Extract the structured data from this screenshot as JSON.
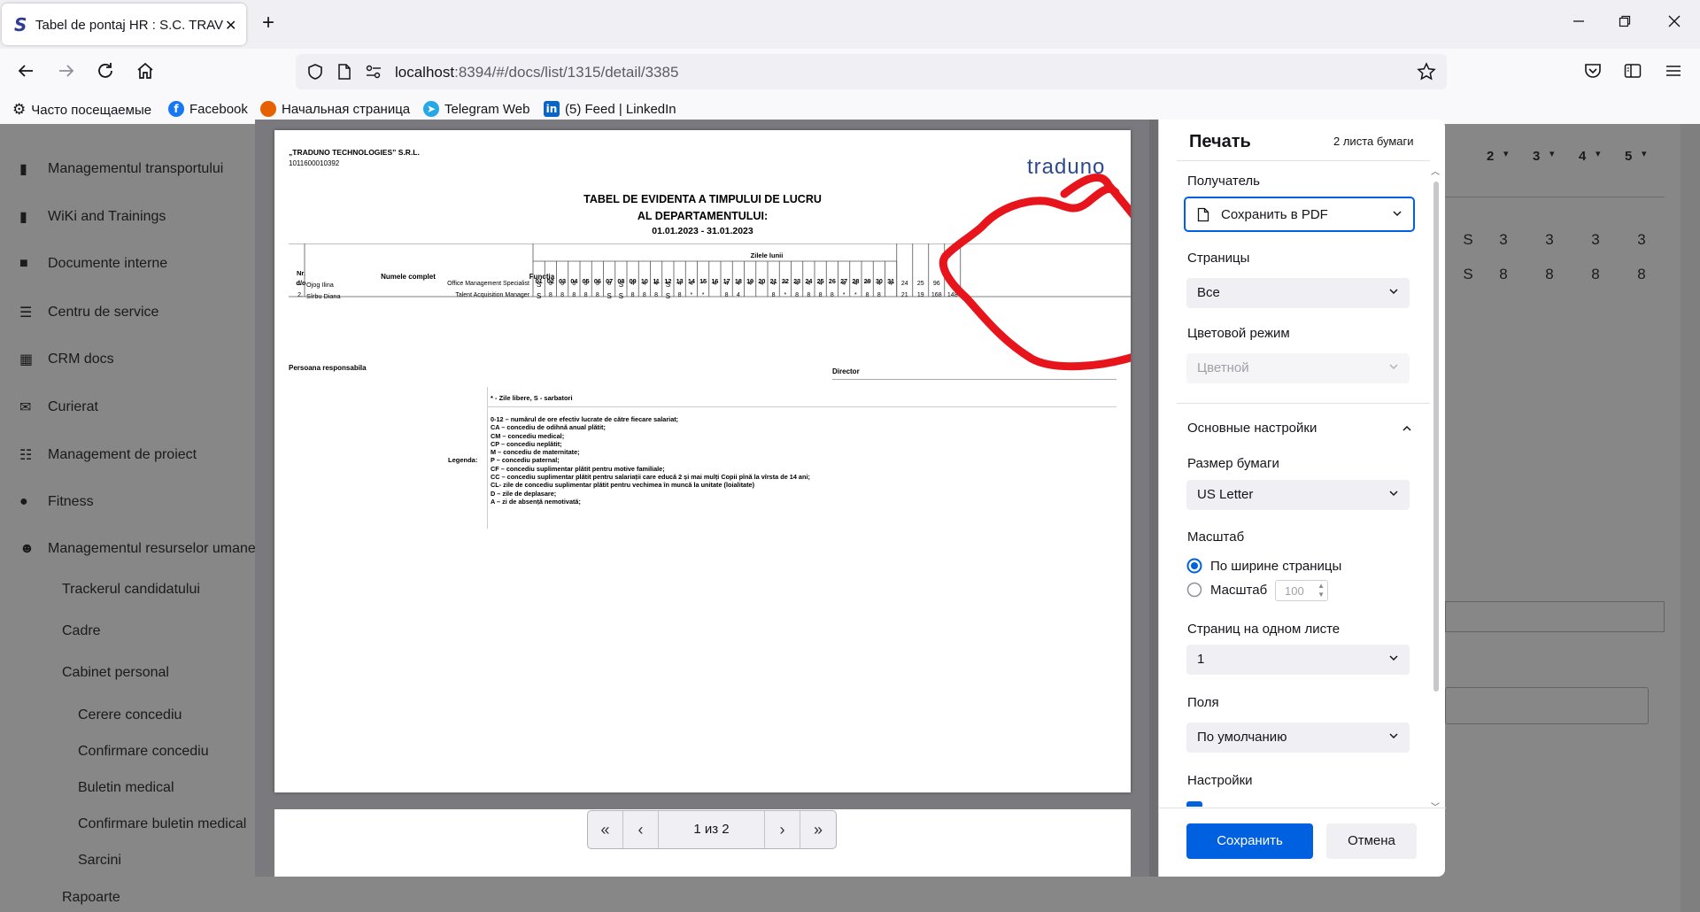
{
  "browser": {
    "tab_title": "Tabel de pontaj HR : S.C. TRAVO",
    "url_host": "localhost",
    "url_rest": ":8394/#/docs/list/1315/detail/3385",
    "bookmarks": [
      "Часто посещаемые",
      "Facebook",
      "Начальная страница",
      "Telegram Web",
      "(5) Feed | LinkedIn"
    ]
  },
  "sidebar": {
    "items": [
      {
        "label": "Managementul transportului",
        "icon": "truck-icon"
      },
      {
        "label": "WiKi and Trainings",
        "icon": "book-icon"
      },
      {
        "label": "Documente interne",
        "icon": "comment-icon"
      },
      {
        "label": "Centru de service",
        "icon": "list-icon"
      },
      {
        "label": "CRM docs",
        "icon": "calendar-icon"
      },
      {
        "label": "Curierat",
        "icon": "envelope-icon"
      },
      {
        "label": "Management de proiect",
        "icon": "tasks-icon"
      },
      {
        "label": "Fitness",
        "icon": "apple-icon"
      },
      {
        "label": "Managementul resurselor umane",
        "icon": "users-icon"
      }
    ],
    "subitems": [
      "Trackerul candidatului",
      "Cadre",
      "Cabinet personal"
    ],
    "subsubitems": [
      "Cerere concediu",
      "Confirmare concediu",
      "Buletin medical",
      "Confirmare buletin medical",
      "Sarcini"
    ],
    "bottom": "Rapoarte"
  },
  "background_grid": {
    "day_headers": [
      "2",
      "3",
      "4",
      "5"
    ],
    "row1": [
      "S",
      "3",
      "3",
      "3",
      "3"
    ],
    "row2": [
      "S",
      "8",
      "8",
      "8",
      "8"
    ]
  },
  "document": {
    "company": "„TRADUNO TECHNOLOGIES” S.R.L.",
    "idno": "1011600010392",
    "logo": "traduno",
    "title_line1": "TABEL DE EVIDENTA A TIMPULUI DE LUCRU",
    "title_line2": "AL DEPARTAMENTULUI:",
    "period": "01.01.2023 - 31.01.2023",
    "col_nr": "Nr. d/o",
    "col_name": "Numele complet",
    "col_function": "Funcția",
    "col_days": "Zilele lunii",
    "days": [
      "01",
      "02",
      "03",
      "04",
      "05",
      "06",
      "07",
      "08",
      "09",
      "10",
      "11",
      "12",
      "13",
      "14",
      "15",
      "16",
      "17",
      "18",
      "19",
      "20",
      "21",
      "22",
      "23",
      "24",
      "25",
      "26",
      "27",
      "28",
      "29",
      "30",
      "31"
    ],
    "rows": [
      {
        "nr": "1.",
        "name": "Ojog Ilina",
        "function": "Office Management Specialist",
        "cells": [
          "S",
          "3",
          "3",
          "3",
          "3",
          "3",
          "8",
          "S",
          "4",
          "4",
          "4",
          "S",
          "4",
          "4",
          "*",
          "4",
          "4",
          "4",
          "4",
          "4",
          "4",
          "*",
          "4",
          "4",
          "4",
          "",
          "4",
          "4",
          "*",
          "4",
          "4"
        ],
        "totals": [
          "24",
          "25",
          "96",
          "99"
        ]
      },
      {
        "nr": "2.",
        "name": "Sîrbu Diana",
        "function": "Talent Acquisition Manager",
        "cells": [
          "S",
          "8",
          "8",
          "8",
          "8",
          "8",
          "S",
          "S",
          "8",
          "8",
          "8",
          "S",
          "8",
          "*",
          "*",
          "",
          "8",
          "4",
          "",
          "",
          "8",
          "*",
          "8",
          "8",
          "8",
          "8",
          "*",
          "*",
          "8",
          "8",
          ""
        ],
        "totals": [
          "21",
          "19",
          "168",
          "148"
        ]
      }
    ],
    "responsible": "Persoana responsabila",
    "director": "Director",
    "legend_title": "Legenda:",
    "legend_first": "* - Zile libere, S - sarbatori",
    "legend_lines": [
      "0-12 – numărul de ore efectiv lucrate de către fiecare salariat;",
      "CA – concediu de odihnă anual plătit;",
      "CM – concediu medical;",
      "CP – concediu neplătit;",
      "M – concediu de maternitate;",
      "P – concediu paternal;",
      "CF – concediu suplimentar plătit pentru motive familiale;",
      "CC – concediu suplimentar plătit pentru salariații care educă 2 și mai mulți Copii pînă la vîrsta de 14 ani;",
      "CL- zile de concediu suplimentar plătit pentru vechimea în muncă la unitate (loialitate)",
      "D – zile de deplasare;",
      "A – zi de absență nemotivată;"
    ]
  },
  "pager": {
    "text": "1 из 2"
  },
  "print_dialog": {
    "title": "Печать",
    "sheets": "2 листа бумаги",
    "destination_label": "Получатель",
    "destination_value": "Сохранить в PDF",
    "pages_label": "Страницы",
    "pages_value": "Все",
    "color_label": "Цветовой режим",
    "color_value": "Цветной",
    "basic_settings": "Основные настройки",
    "paper_size_label": "Размер бумаги",
    "paper_size_value": "US Letter",
    "scale_label": "Масштаб",
    "scale_fit": "По ширине страницы",
    "scale_custom": "Масштаб",
    "scale_value": "100",
    "pages_per_sheet_label": "Страниц на одном листе",
    "pages_per_sheet_value": "1",
    "margins_label": "Поля",
    "margins_value": "По умолчанию",
    "settings_label": "Настройки",
    "save_button": "Сохранить",
    "cancel_button": "Отмена"
  },
  "colors": {
    "accent": "#0061e0",
    "annotation": "#e8141c"
  }
}
